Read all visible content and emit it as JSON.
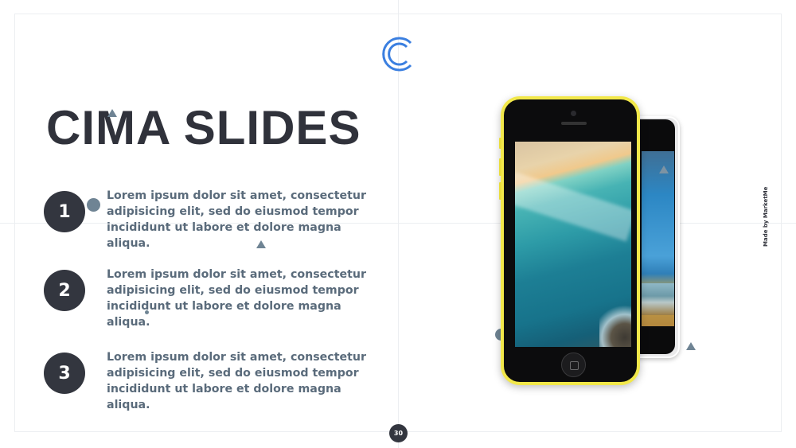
{
  "slide": {
    "title": "CIMA SLIDES",
    "page_number": "30",
    "watermark": "Made by MarketMe"
  },
  "items": [
    {
      "number": "1",
      "text": "Lorem ipsum dolor sit amet, consectetur adipisicing elit, sed do eiusmod tempor incididunt ut labore et dolore magna aliqua."
    },
    {
      "number": "2",
      "text": "Lorem ipsum dolor sit amet, consectetur adipisicing elit, sed do eiusmod tempor incididunt ut labore et dolore magna aliqua."
    },
    {
      "number": "3",
      "text": "Lorem ipsum dolor sit amet, consectetur adipisicing elit, sed do eiusmod tempor incididunt ut labore et dolore magna aliqua."
    }
  ],
  "colors": {
    "title": "#30323b",
    "body_text": "#5a6b7b",
    "badge": "#33363f",
    "logo": "#3b7fe0",
    "accent_shapes": "#6f8494",
    "phone_front": "#f2e84a"
  },
  "icons": {
    "logo": "c-logo-icon"
  }
}
